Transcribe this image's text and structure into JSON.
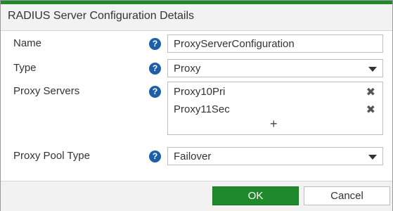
{
  "dialog": {
    "title": "RADIUS Server Configuration Details"
  },
  "form": {
    "name": {
      "label": "Name",
      "value": "ProxyServerConfiguration"
    },
    "type": {
      "label": "Type",
      "value": "Proxy"
    },
    "proxy_servers": {
      "label": "Proxy Servers",
      "items": [
        "Proxy10Pri",
        "Proxy11Sec"
      ],
      "add_glyph": "+",
      "remove_glyph": "✖"
    },
    "proxy_pool_type": {
      "label": "Proxy Pool Type",
      "value": "Failover"
    },
    "help_glyph": "?"
  },
  "footer": {
    "ok_label": "OK",
    "cancel_label": "Cancel"
  },
  "colors": {
    "accent": "#1f8a2c",
    "help_icon": "#1b5fa8"
  },
  "icons": [
    "help-icon",
    "dropdown-caret-icon",
    "remove-icon",
    "add-icon"
  ]
}
